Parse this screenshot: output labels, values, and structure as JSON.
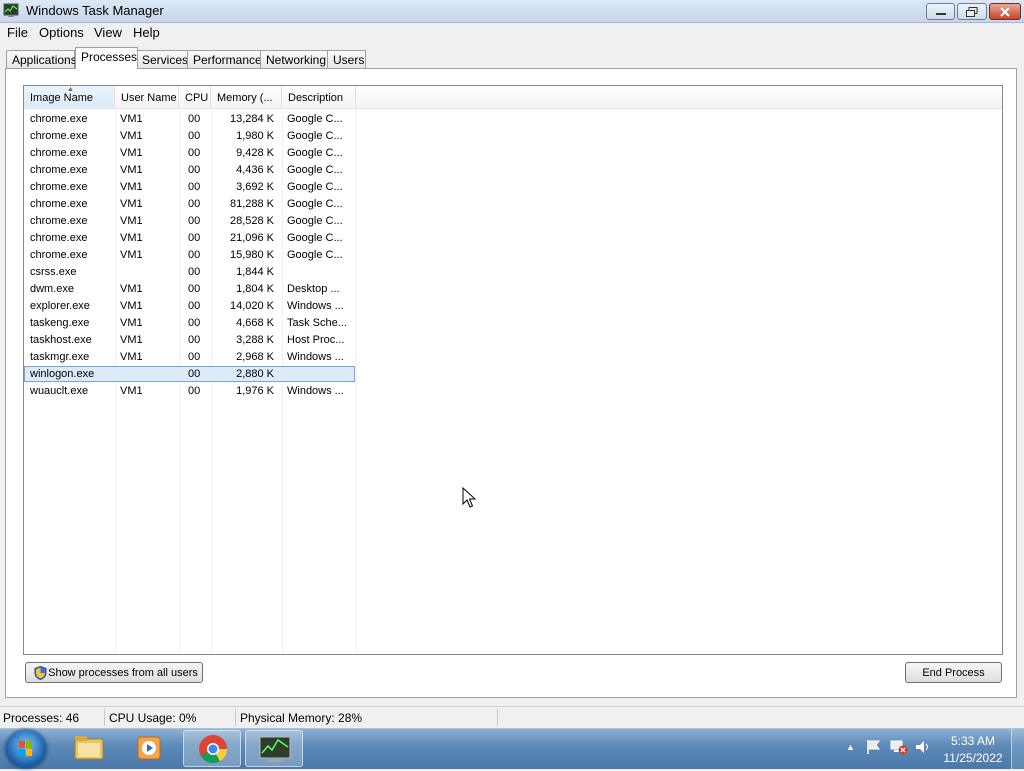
{
  "window": {
    "title": "Windows Task Manager"
  },
  "menu": [
    "File",
    "Options",
    "View",
    "Help"
  ],
  "tabs": [
    "Applications",
    "Processes",
    "Services",
    "Performance",
    "Networking",
    "Users"
  ],
  "active_tab": "Processes",
  "table": {
    "columns": [
      "Image Name",
      "User Name",
      "CPU",
      "Memory (...",
      "Description"
    ],
    "sorted_column": "Image Name",
    "selected_row_index": 15,
    "rows": [
      [
        "chrome.exe",
        "VM1",
        "00",
        "13,284 K",
        "Google C..."
      ],
      [
        "chrome.exe",
        "VM1",
        "00",
        "1,980 K",
        "Google C..."
      ],
      [
        "chrome.exe",
        "VM1",
        "00",
        "9,428 K",
        "Google C..."
      ],
      [
        "chrome.exe",
        "VM1",
        "00",
        "4,436 K",
        "Google C..."
      ],
      [
        "chrome.exe",
        "VM1",
        "00",
        "3,692 K",
        "Google C..."
      ],
      [
        "chrome.exe",
        "VM1",
        "00",
        "81,288 K",
        "Google C..."
      ],
      [
        "chrome.exe",
        "VM1",
        "00",
        "28,528 K",
        "Google C..."
      ],
      [
        "chrome.exe",
        "VM1",
        "00",
        "21,096 K",
        "Google C..."
      ],
      [
        "chrome.exe",
        "VM1",
        "00",
        "15,980 K",
        "Google C..."
      ],
      [
        "csrss.exe",
        "",
        "00",
        "1,844 K",
        ""
      ],
      [
        "dwm.exe",
        "VM1",
        "00",
        "1,804 K",
        "Desktop ..."
      ],
      [
        "explorer.exe",
        "VM1",
        "00",
        "14,020 K",
        "Windows ..."
      ],
      [
        "taskeng.exe",
        "VM1",
        "00",
        "4,668 K",
        "Task Sche..."
      ],
      [
        "taskhost.exe",
        "VM1",
        "00",
        "3,288 K",
        "Host Proc..."
      ],
      [
        "taskmgr.exe",
        "VM1",
        "00",
        "2,968 K",
        "Windows ..."
      ],
      [
        "winlogon.exe",
        "",
        "00",
        "2,880 K",
        ""
      ],
      [
        "wuauclt.exe",
        "VM1",
        "00",
        "1,976 K",
        "Windows ..."
      ]
    ]
  },
  "buttons": {
    "show_all": "Show processes from all users",
    "end_process": "End Process"
  },
  "status": {
    "processes": "Processes: 46",
    "cpu": "CPU Usage: 0%",
    "memory": "Physical Memory: 28%"
  },
  "taskbar": {
    "items": [
      "start-orb-icon",
      "explorer-folder-icon",
      "media-player-icon",
      "chrome-icon",
      "task-manager-icon"
    ],
    "time": "5:33 AM",
    "date": "11/25/2022"
  },
  "colors": {
    "selection": "#dceafa",
    "selection_border": "#7da2ce",
    "taskbar": "#5d8ab8"
  }
}
